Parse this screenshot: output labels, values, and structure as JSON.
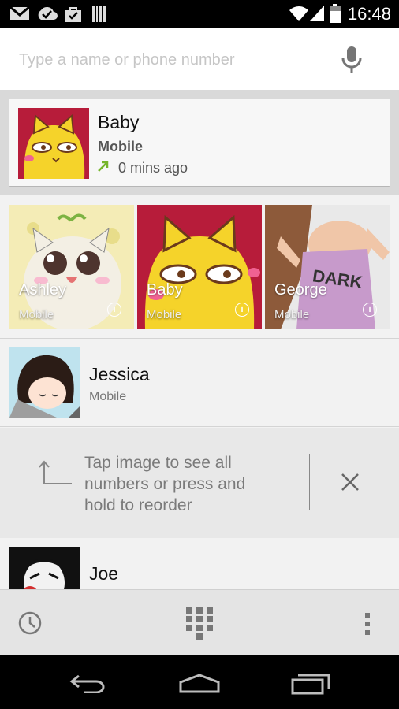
{
  "status_bar": {
    "time": "16:48"
  },
  "search": {
    "placeholder": "Type a name or phone number"
  },
  "recent_call": {
    "name": "Baby",
    "type": "Mobile",
    "time": "0 mins ago"
  },
  "favorites": [
    {
      "name": "Ashley",
      "type": "Mobile"
    },
    {
      "name": "Baby",
      "type": "Mobile"
    },
    {
      "name": "George",
      "type": "Mobile"
    }
  ],
  "contacts": [
    {
      "name": "Jessica",
      "type": "Mobile"
    },
    {
      "name": "Joe"
    }
  ],
  "hint": {
    "text": "Tap image to see all numbers or press and hold to reorder"
  },
  "colors": {
    "accent_green": "#76b62b",
    "tile_pink": "#c2185b"
  }
}
